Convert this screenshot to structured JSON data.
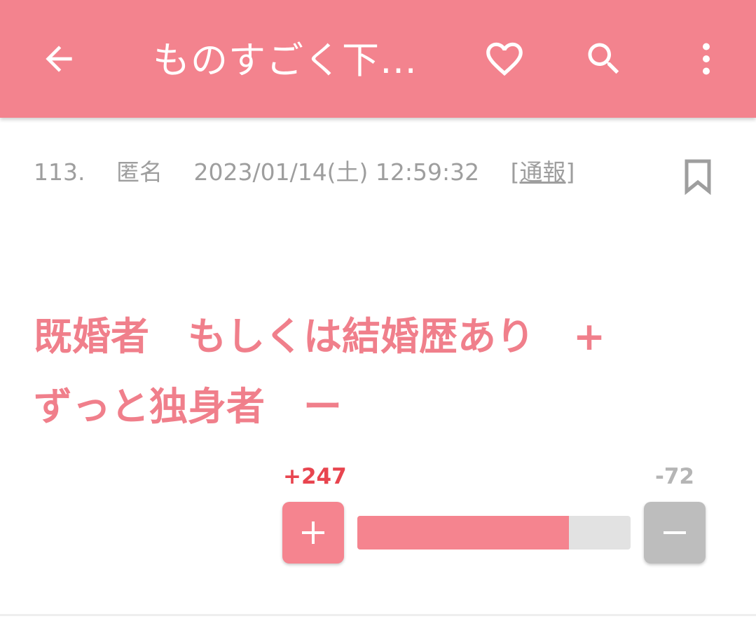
{
  "appbar": {
    "title": "ものすごく下…",
    "icons": [
      "arrow-left-icon",
      "heart-outline-icon",
      "search-icon",
      "more-vert-icon"
    ],
    "background": "#f3838e"
  },
  "comment": {
    "number": "113.",
    "author": "匿名",
    "datetime": "2023/01/14(土) 12:59:32",
    "report_open": "[",
    "report_label": "通報",
    "report_close": "]",
    "body_line1": "既婚者　もしくは結婚歴あり　+",
    "body_line2": "ずっと独身者　ー",
    "body_color": "#f07f8b"
  },
  "vote": {
    "plus_count": "+247",
    "minus_count": "-72",
    "plus_label": "+",
    "minus_label": "−",
    "plus_ratio": 0.774,
    "plus_color": "#f5848f",
    "minus_color": "#bdbdbd"
  }
}
